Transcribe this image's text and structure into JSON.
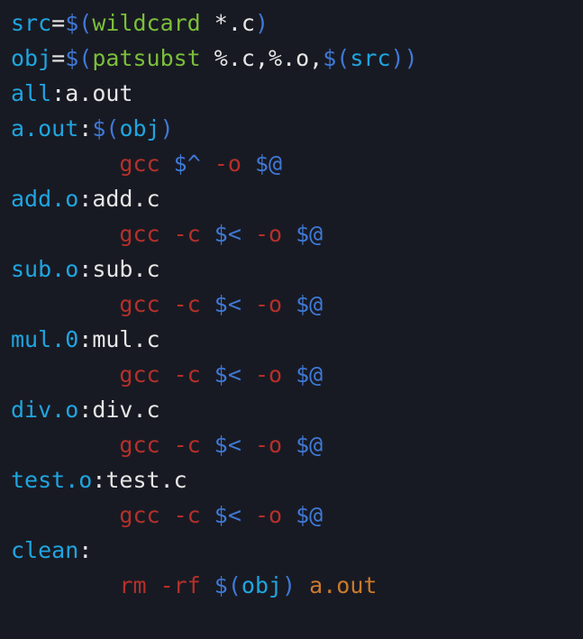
{
  "code": {
    "lines": [
      {
        "indent": 0,
        "tokens": [
          {
            "cls": "t-cyan",
            "text": "src"
          },
          {
            "cls": "t-punc",
            "text": "="
          },
          {
            "cls": "t-blue",
            "text": "$("
          },
          {
            "cls": "t-green",
            "text": "wildcard "
          },
          {
            "cls": "t-white",
            "text": "*.c"
          },
          {
            "cls": "t-blue",
            "text": ")"
          }
        ]
      },
      {
        "indent": 0,
        "tokens": [
          {
            "cls": "t-cyan",
            "text": "obj"
          },
          {
            "cls": "t-punc",
            "text": "="
          },
          {
            "cls": "t-blue",
            "text": "$("
          },
          {
            "cls": "t-green",
            "text": "patsubst "
          },
          {
            "cls": "t-white",
            "text": "%.c"
          },
          {
            "cls": "t-punc",
            "text": ","
          },
          {
            "cls": "t-white",
            "text": "%.o"
          },
          {
            "cls": "t-punc",
            "text": ","
          },
          {
            "cls": "t-blue",
            "text": "$("
          },
          {
            "cls": "t-cyan",
            "text": "src"
          },
          {
            "cls": "t-blue",
            "text": ")"
          },
          {
            "cls": "t-blue",
            "text": ")"
          }
        ]
      },
      {
        "indent": 0,
        "tokens": [
          {
            "cls": "t-cyan",
            "text": "all"
          },
          {
            "cls": "t-punc",
            "text": ":"
          },
          {
            "cls": "t-white",
            "text": "a.out"
          }
        ]
      },
      {
        "indent": 0,
        "tokens": [
          {
            "cls": "t-cyan",
            "text": "a.out"
          },
          {
            "cls": "t-punc",
            "text": ":"
          },
          {
            "cls": "t-blue",
            "text": "$("
          },
          {
            "cls": "t-cyan",
            "text": "obj"
          },
          {
            "cls": "t-blue",
            "text": ")"
          }
        ]
      },
      {
        "indent": 1,
        "tokens": [
          {
            "cls": "t-red",
            "text": "gcc "
          },
          {
            "cls": "t-blue",
            "text": "$^"
          },
          {
            "cls": "t-red",
            "text": " -o "
          },
          {
            "cls": "t-blue",
            "text": "$@"
          }
        ]
      },
      {
        "indent": 0,
        "tokens": [
          {
            "cls": "t-cyan",
            "text": "add.o"
          },
          {
            "cls": "t-punc",
            "text": ":"
          },
          {
            "cls": "t-white",
            "text": "add.c"
          }
        ]
      },
      {
        "indent": 1,
        "tokens": [
          {
            "cls": "t-red",
            "text": "gcc -c "
          },
          {
            "cls": "t-blue",
            "text": "$<"
          },
          {
            "cls": "t-red",
            "text": " -o "
          },
          {
            "cls": "t-blue",
            "text": "$@"
          }
        ]
      },
      {
        "indent": 0,
        "tokens": [
          {
            "cls": "t-cyan",
            "text": "sub.o"
          },
          {
            "cls": "t-punc",
            "text": ":"
          },
          {
            "cls": "t-white",
            "text": "sub.c"
          }
        ]
      },
      {
        "indent": 1,
        "tokens": [
          {
            "cls": "t-red",
            "text": "gcc -c "
          },
          {
            "cls": "t-blue",
            "text": "$<"
          },
          {
            "cls": "t-red",
            "text": " -o "
          },
          {
            "cls": "t-blue",
            "text": "$@"
          }
        ]
      },
      {
        "indent": 0,
        "tokens": [
          {
            "cls": "t-cyan",
            "text": "mul.0"
          },
          {
            "cls": "t-punc",
            "text": ":"
          },
          {
            "cls": "t-white",
            "text": "mul.c"
          }
        ]
      },
      {
        "indent": 1,
        "tokens": [
          {
            "cls": "t-red",
            "text": "gcc -c "
          },
          {
            "cls": "t-blue",
            "text": "$<"
          },
          {
            "cls": "t-red",
            "text": " -o "
          },
          {
            "cls": "t-blue",
            "text": "$@"
          }
        ]
      },
      {
        "indent": 0,
        "tokens": [
          {
            "cls": "t-cyan",
            "text": "div.o"
          },
          {
            "cls": "t-punc",
            "text": ":"
          },
          {
            "cls": "t-white",
            "text": "div.c"
          }
        ]
      },
      {
        "indent": 1,
        "tokens": [
          {
            "cls": "t-red",
            "text": "gcc -c "
          },
          {
            "cls": "t-blue",
            "text": "$<"
          },
          {
            "cls": "t-red",
            "text": " -o "
          },
          {
            "cls": "t-blue",
            "text": "$@"
          }
        ]
      },
      {
        "indent": 0,
        "tokens": [
          {
            "cls": "t-cyan",
            "text": "test.o"
          },
          {
            "cls": "t-punc",
            "text": ":"
          },
          {
            "cls": "t-white",
            "text": "test.c"
          }
        ]
      },
      {
        "indent": 1,
        "tokens": [
          {
            "cls": "t-red",
            "text": "gcc -c "
          },
          {
            "cls": "t-blue",
            "text": "$<"
          },
          {
            "cls": "t-red",
            "text": " -o "
          },
          {
            "cls": "t-blue",
            "text": "$@"
          }
        ]
      },
      {
        "indent": 0,
        "tokens": [
          {
            "cls": "t-cyan",
            "text": "clean"
          },
          {
            "cls": "t-punc",
            "text": ":"
          }
        ]
      },
      {
        "indent": 1,
        "tokens": [
          {
            "cls": "t-red",
            "text": "rm -rf "
          },
          {
            "cls": "t-blue",
            "text": "$("
          },
          {
            "cls": "t-cyan",
            "text": "obj"
          },
          {
            "cls": "t-blue",
            "text": ")"
          },
          {
            "cls": "t-red",
            "text": " "
          },
          {
            "cls": "t-orange",
            "text": "a.out"
          }
        ]
      }
    ]
  }
}
